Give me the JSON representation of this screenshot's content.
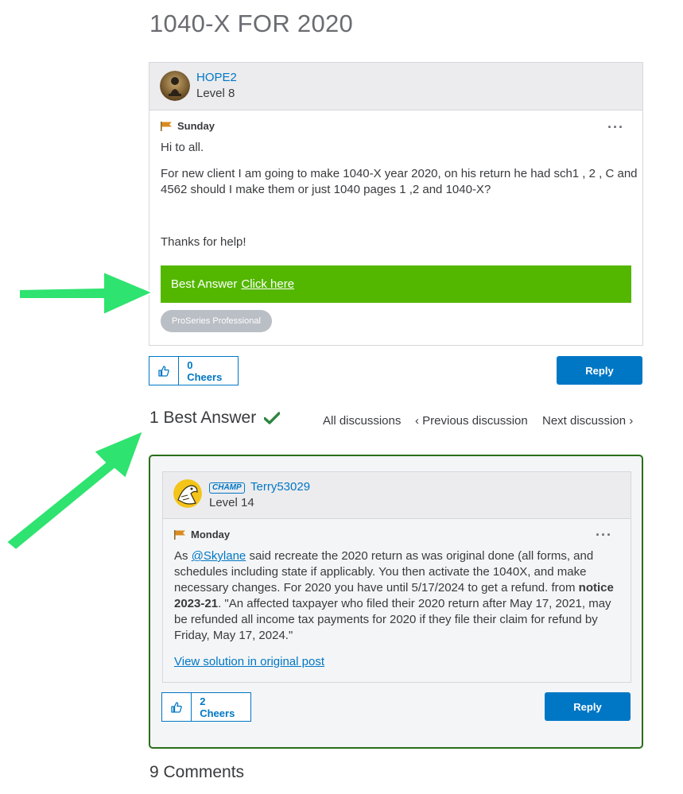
{
  "page": {
    "title": "1040-X FOR 2020"
  },
  "question": {
    "author": "HOPE2",
    "level": "Level 8",
    "day": "Sunday",
    "more_label": "···",
    "body": [
      "Hi to all.",
      "For new client I am going to make 1040-X year 2020, on his return he had sch1 , 2 , C and 4562 should I make them or just 1040 pages 1 ,2 and 1040-X?",
      "Thanks for help!"
    ],
    "best_answer_label": "Best Answer",
    "best_answer_link": "Click here",
    "tag": "ProSeries Professional",
    "cheers": "0 Cheers",
    "reply": "Reply"
  },
  "best_answer_section": {
    "title": "1 Best Answer",
    "nav": {
      "all": "All discussions",
      "previous": "‹  Previous discussion",
      "next": "Next discussion  ›"
    }
  },
  "answer": {
    "badge": "CHAMP",
    "author": "Terry53029",
    "level": "Level 14",
    "day": "Monday",
    "more_label": "···",
    "text_prefix": "As ",
    "mention": "@Skylane",
    "text_main": " said recreate the 2020 return as was original done (all forms, and schedules including state if applicably. You then activate the 1040X, and make necessary changes. For 2020 you have until 5/17/2024 to get a refund. from ",
    "text_bold": "notice 2023-21",
    "text_quote": ".   \"An affected taxpayer who filed their 2020 return after May 17, 2021, may be refunded all income tax payments for 2020 if they file their claim for refund by Friday, May 17, 2024.\"",
    "view_solution": "View solution in original post",
    "cheers": "2 Cheers",
    "reply": "Reply"
  },
  "comments": {
    "title": "9 Comments"
  },
  "colors": {
    "accent_blue": "#0077c5",
    "best_answer_green": "#53b700",
    "answer_border": "#2a6e1a",
    "arrow_green": "#2ee36f"
  },
  "icons": {
    "flag": "flag-icon",
    "thumb": "thumbs-up-icon",
    "check": "checkmark-icon",
    "more": "more-options-icon"
  }
}
